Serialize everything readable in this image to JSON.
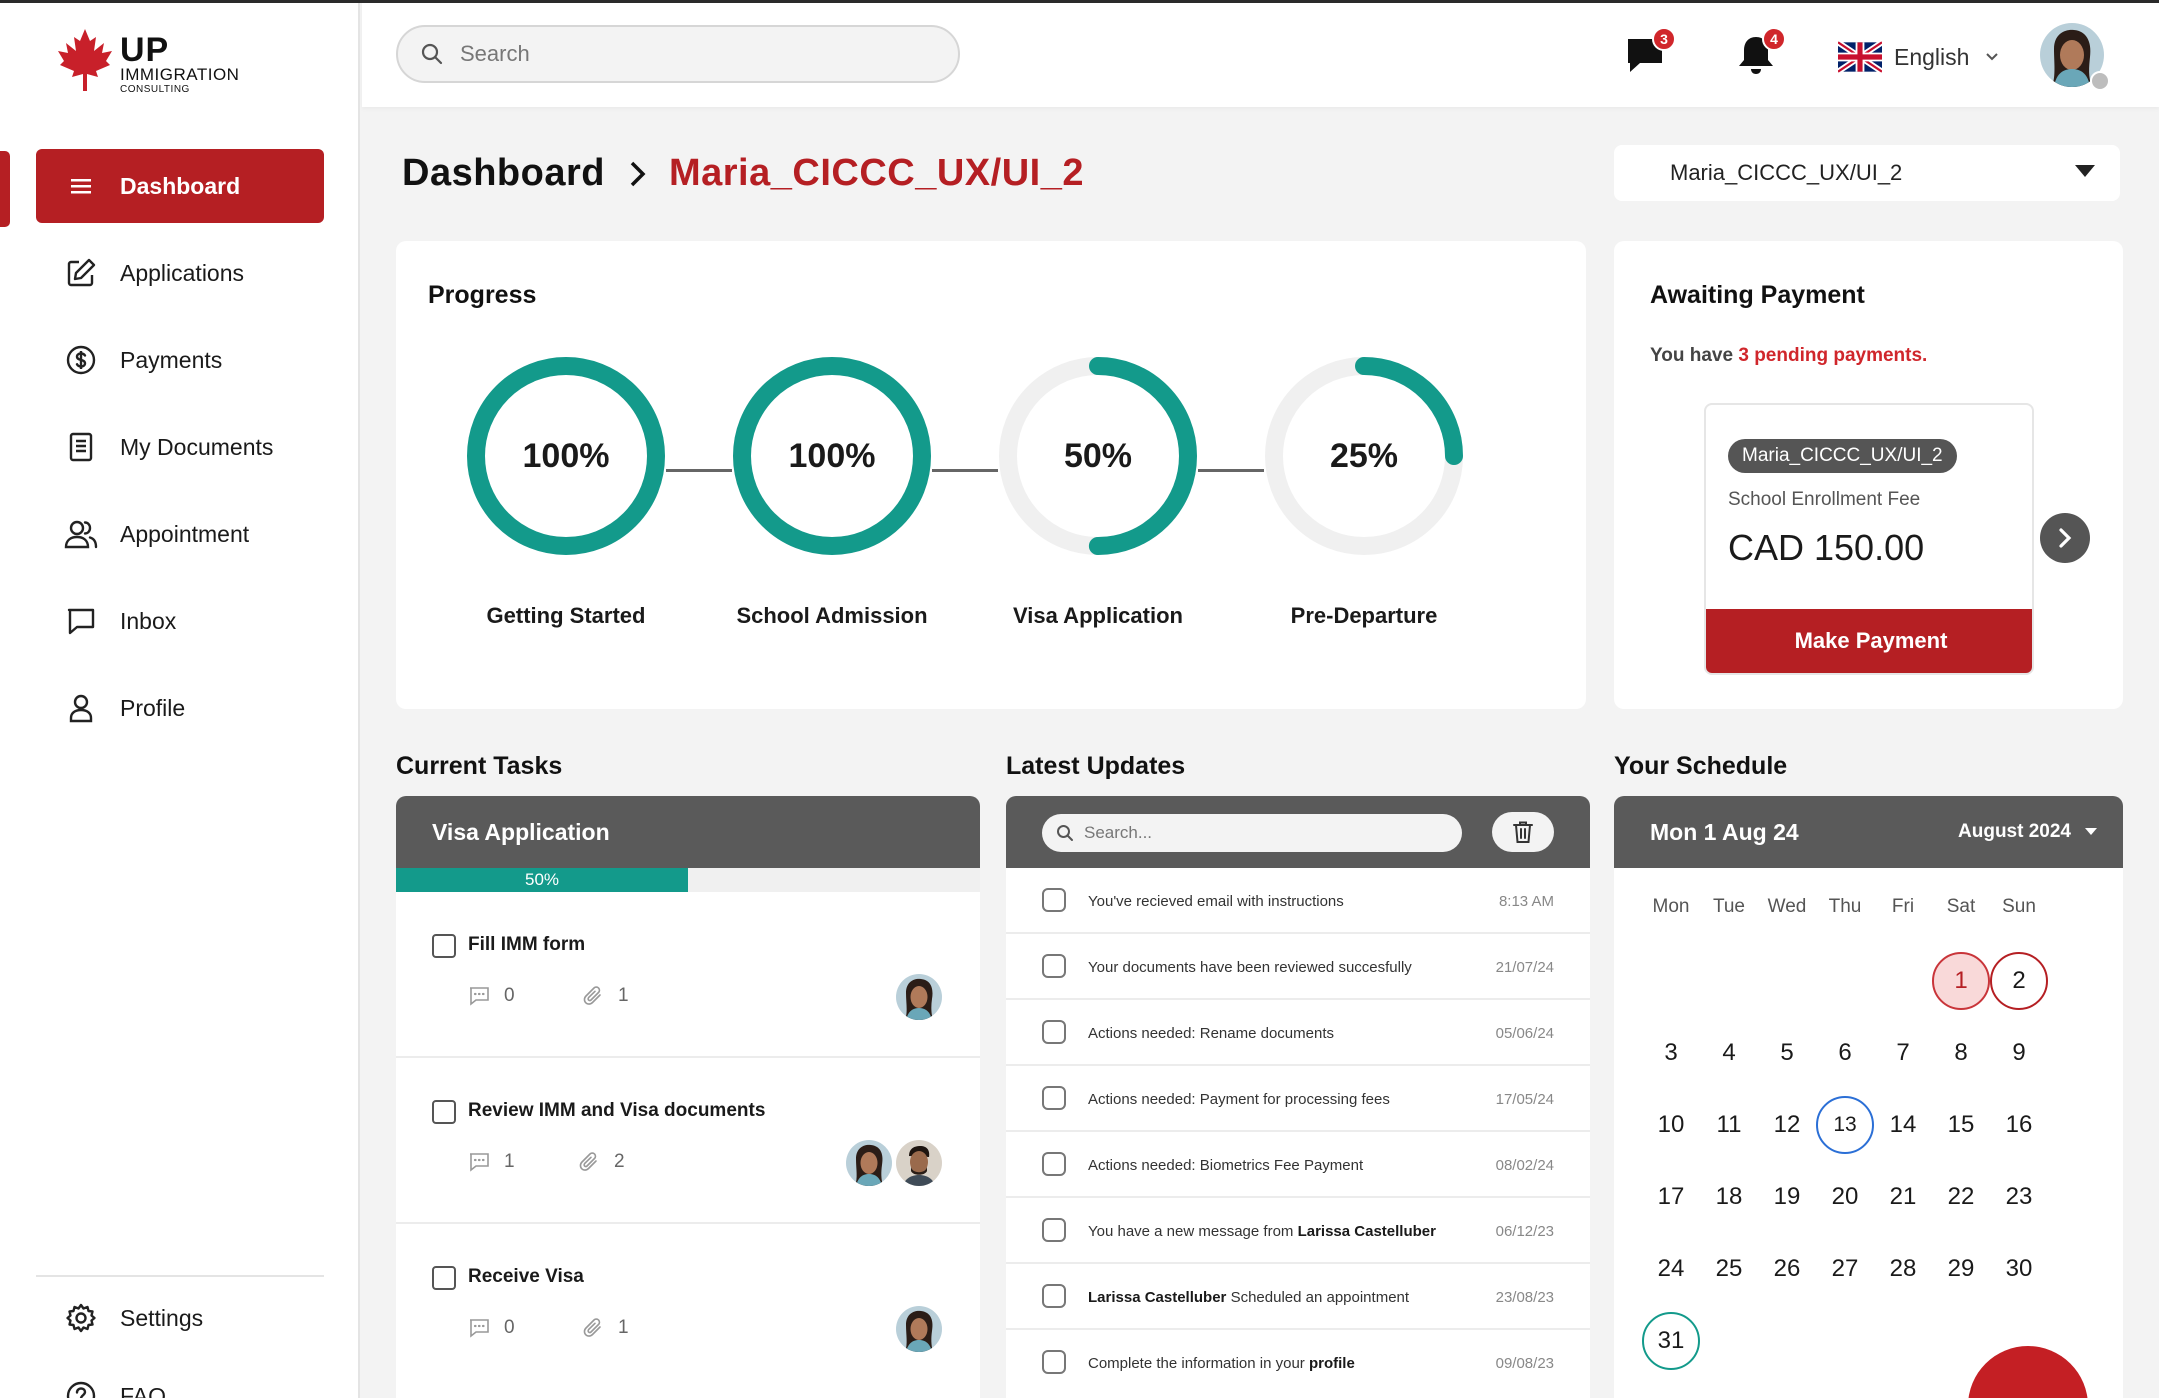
{
  "brand": {
    "name_line1": "UP",
    "name_line2": "IMMIGRATION",
    "name_line3": "CONSULTING",
    "color": "#b51f23"
  },
  "sidebar": {
    "items": [
      {
        "label": "Dashboard",
        "icon": "menu-icon",
        "active": true
      },
      {
        "label": "Applications",
        "icon": "edit-icon"
      },
      {
        "label": "Payments",
        "icon": "dollar-icon"
      },
      {
        "label": "My Documents",
        "icon": "document-icon"
      },
      {
        "label": "Appointment",
        "icon": "users-icon"
      },
      {
        "label": "Inbox",
        "icon": "chat-icon"
      },
      {
        "label": "Profile",
        "icon": "user-icon"
      }
    ],
    "bottom_items": [
      {
        "label": "Settings",
        "icon": "gear-icon"
      },
      {
        "label": "FAQ",
        "icon": "help-icon"
      }
    ]
  },
  "header": {
    "search_placeholder": "Search",
    "messages_count": "3",
    "notifications_count": "4",
    "language": "English"
  },
  "breadcrumb": {
    "root": "Dashboard",
    "current": "Maria_CICCC_UX/UI_2"
  },
  "project_select": {
    "value": "Maria_CICCC_UX/UI_2"
  },
  "progress": {
    "title": "Progress",
    "steps": [
      {
        "label": "Getting Started",
        "percent": 100,
        "display": "100%"
      },
      {
        "label": "School Admission",
        "percent": 100,
        "display": "100%"
      },
      {
        "label": "Visa Application",
        "percent": 50,
        "display": "50%"
      },
      {
        "label": "Pre-Departure",
        "percent": 25,
        "display": "25%"
      }
    ],
    "color": "#139a8b"
  },
  "payment": {
    "title": "Awaiting Payment",
    "pending_lead": "You have",
    "pending_highlight": "3 pending payments.",
    "tag": "Maria_CICCC_UX/UI_2",
    "fee_name": "School Enrollment Fee",
    "amount": "CAD 150.00",
    "button": "Make Payment"
  },
  "tasks": {
    "section_title": "Current Tasks",
    "header": "Visa Application",
    "progress": 0.5,
    "progress_label": "50%",
    "items": [
      {
        "name": "Fill IMM form",
        "comments": "0",
        "attachments": "1"
      },
      {
        "name": "Review IMM and Visa documents",
        "comments": "1",
        "attachments": "2"
      },
      {
        "name": "Receive Visa",
        "comments": "0",
        "attachments": "1"
      }
    ]
  },
  "updates": {
    "section_title": "Latest Updates",
    "search_placeholder": "Search...",
    "rows": [
      {
        "pre": "You've recieved email with instructions",
        "bold": "",
        "post": "",
        "date": "8:13 AM"
      },
      {
        "pre": "Your documents have been reviewed succesfully",
        "bold": "",
        "post": "",
        "date": "21/07/24"
      },
      {
        "pre": "Actions needed: Rename documents",
        "bold": "",
        "post": "",
        "date": "05/06/24"
      },
      {
        "pre": "Actions needed: Payment for processing fees",
        "bold": "",
        "post": "",
        "date": "17/05/24"
      },
      {
        "pre": "Actions needed: Biometrics Fee Payment",
        "bold": "",
        "post": "",
        "date": "08/02/24"
      },
      {
        "pre": "You have a new message from ",
        "bold": "Larissa Castelluber",
        "post": "",
        "date": "06/12/23"
      },
      {
        "pre": "",
        "bold": "Larissa Castelluber",
        "post": " Scheduled an appointment",
        "date": "23/08/23"
      },
      {
        "pre": "Complete the information in your ",
        "bold": "profile",
        "post": "",
        "date": "09/08/23"
      }
    ]
  },
  "schedule": {
    "section_title": "Your Schedule",
    "selected_date": "Mon 1 Aug 24",
    "month": "August 2024",
    "weekdays": [
      "Mon",
      "Tue",
      "Wed",
      "Thu",
      "Fri",
      "Sat",
      "Sun"
    ],
    "first_weekday_index": 5,
    "days_in_month": 31,
    "highlights": {
      "1": "sel",
      "2": "red",
      "13": "blue",
      "31": "teal"
    }
  }
}
